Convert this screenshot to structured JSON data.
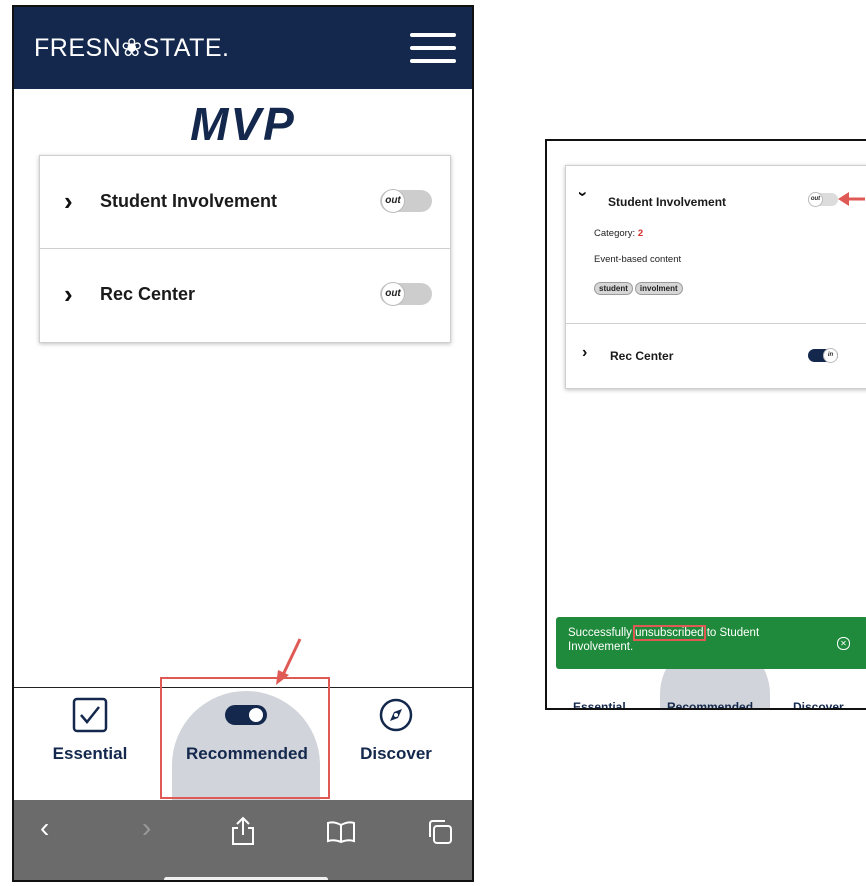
{
  "left_screen": {
    "logo": "FRESN❀STATE.",
    "title": "MVP",
    "items": [
      {
        "label": "Student Involvement",
        "toggle": "out",
        "chevron": "›"
      },
      {
        "label": "Rec Center",
        "toggle": "out",
        "chevron": "›"
      }
    ],
    "nav": [
      {
        "label": "Essential",
        "icon": "checkbox-icon"
      },
      {
        "label": "Recommended",
        "icon": "toggle-icon",
        "active": true
      },
      {
        "label": "Discover",
        "icon": "compass-icon"
      }
    ],
    "browser_bar": [
      "back-icon",
      "forward-icon",
      "share-icon",
      "bookmarks-icon",
      "tabs-icon"
    ],
    "colors": {
      "brand": "#13284c",
      "highlight": "#e05a55",
      "browser_bar": "#6b6b6b",
      "active_nav": "#d1d4da"
    }
  },
  "right_screen": {
    "items": [
      {
        "label": "Student Involvement",
        "toggle": "out",
        "expanded": true,
        "category_label": "Category:",
        "category_value": "2",
        "description": "Event-based content",
        "tags": [
          "student",
          "involment"
        ]
      },
      {
        "label": "Rec Center",
        "toggle": "in",
        "expanded": false
      }
    ],
    "nav": [
      {
        "label": "Essential"
      },
      {
        "label": "Recommended",
        "active": true
      },
      {
        "label": "Discover"
      }
    ],
    "toast": {
      "text_before": "Successfully ",
      "highlight": "unsubscribed",
      "text_after": " to Student Involvement.",
      "close_icon": "close-icon"
    },
    "colors": {
      "toast": "#1f8a3b",
      "toggle_on": "#13284c",
      "category_value": "#d32f2f"
    }
  }
}
